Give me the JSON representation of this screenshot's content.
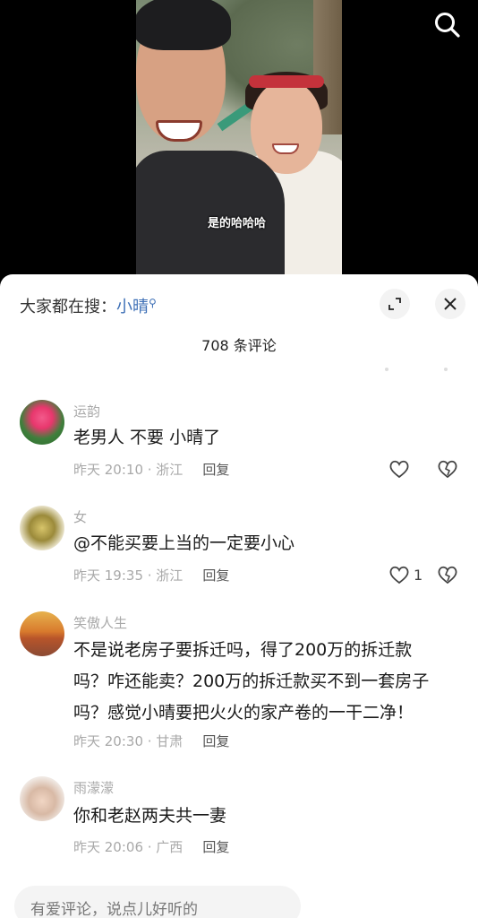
{
  "video": {
    "subtitle": "是的哈哈哈",
    "search_icon": "search-icon"
  },
  "sheet": {
    "search_prefix": "大家都在搜：",
    "search_keyword": "小晴",
    "comment_count": "708 条评论"
  },
  "comments": [
    {
      "username": "运韵",
      "text": "老男人 不要 小晴了",
      "time_location": "昨天 20:10 · 浙江",
      "reply_label": "回复",
      "likes": "",
      "avatar": "lotus-avatar"
    },
    {
      "username": "女",
      "text": "@不能买要上当的一定要小心",
      "time_location": "昨天 19:35 · 浙江",
      "reply_label": "回复",
      "likes": "1",
      "avatar": "plant-avatar"
    },
    {
      "username": "笑傲人生",
      "text_lines": [
        "不是说老房子要拆迁吗，得了200万的拆迁款",
        "吗？咋还能卖？200万的拆迁款买不到一套房子",
        "吗？感觉小晴要把火火的家产卷的一干二净！"
      ],
      "time_location": "昨天 20:30 · 甘肃",
      "reply_label": "回复",
      "avatar": "sunset-avatar"
    },
    {
      "username": "雨濛濛",
      "text": "你和老赵两夫共一妻",
      "time_location": "昨天 20:06 · 广西",
      "reply_label": "回复",
      "avatar": "baby-avatar"
    }
  ],
  "input": {
    "placeholder": "有爱评论，说点儿好听的"
  }
}
